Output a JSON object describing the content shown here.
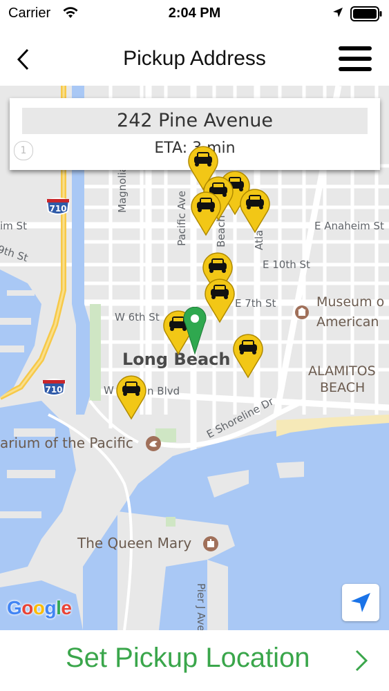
{
  "status_bar": {
    "carrier": "Carrier",
    "time": "2:04 PM"
  },
  "nav": {
    "title": "Pickup Address"
  },
  "address_card": {
    "address": "242 Pine Avenue",
    "eta": "ETA: 3 min"
  },
  "map": {
    "labels": {
      "freeway_710_top": "710",
      "freeway_710_bottom": "710",
      "anaheim_st_left": "im St",
      "e_anaheim_st": "E Anaheim St",
      "ninth_st": "9th St",
      "magnolia_ave": "Magnolia Ave",
      "pacific_ave": "Pacific Ave",
      "beach": "Beach",
      "atla": "Atla",
      "e_10th_st": "E 10th St",
      "e_7th_st": "E 7th St",
      "w_6th_st": "W 6th St",
      "long_beach": "Long Beach",
      "museum_line1": "Museum o",
      "museum_line2": "American",
      "alamitos_line1": "ALAMITOS",
      "alamitos_line2": "BEACH",
      "w_blvd": "W",
      "n_blvd": "n Blvd",
      "aquarium": "arium of the Pacific",
      "e_shoreline_dr": "E Shoreline Dr",
      "queen_mary": "The Queen Mary",
      "pier_j_ave": "Pier J Ave",
      "badge": "1"
    }
  },
  "google_logo": "Google",
  "colors": {
    "accent_green": "#3aa64b",
    "pin_yellow": "#f2c716",
    "water": "#a9c8f5",
    "locate_blue": "#1a73e8"
  },
  "bottom": {
    "set_pickup_label": "Set Pickup Location"
  },
  "icons": {
    "wifi": "wifi-icon",
    "location_arrow": "location-arrow-icon",
    "battery": "battery-icon",
    "back": "chevron-left-icon",
    "menu": "hamburger-menu-icon",
    "car_pin": "car-pin-icon",
    "dest_pin": "map-pin-icon",
    "locate": "navigation-arrow-icon",
    "chevron_right": "chevron-right-icon"
  }
}
